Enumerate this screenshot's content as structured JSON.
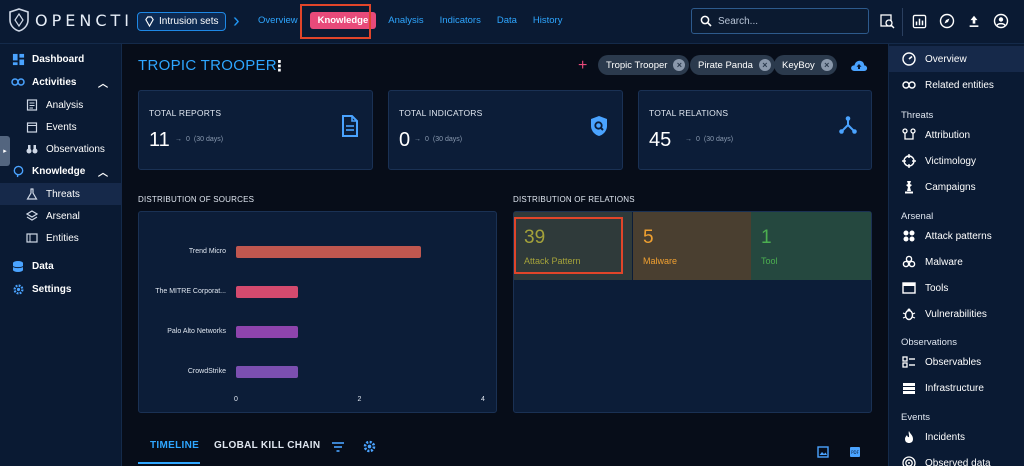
{
  "app": {
    "logo_text": "OPENCTI"
  },
  "header": {
    "entity_type": "Intrusion sets",
    "tabs": [
      "Overview",
      "Knowledge",
      "Analysis",
      "Indicators",
      "Data",
      "History"
    ],
    "active_tab": "Knowledge",
    "search_placeholder": "Search..."
  },
  "sidebar": {
    "items": [
      {
        "label": "Dashboard",
        "icon": "dashboard-icon"
      },
      {
        "label": "Activities",
        "icon": "activities-icon",
        "expanded": true
      },
      {
        "label": "Analysis",
        "icon": "analysis-icon"
      },
      {
        "label": "Events",
        "icon": "events-icon"
      },
      {
        "label": "Observations",
        "icon": "binoculars-icon"
      },
      {
        "label": "Knowledge",
        "icon": "brain-icon",
        "expanded": true
      },
      {
        "label": "Threats",
        "icon": "flask-icon",
        "selected": true
      },
      {
        "label": "Arsenal",
        "icon": "layers-icon"
      },
      {
        "label": "Entities",
        "icon": "entities-icon"
      },
      {
        "label": "Data",
        "icon": "database-icon"
      },
      {
        "label": "Settings",
        "icon": "gear-icon"
      }
    ]
  },
  "entity": {
    "title": "TROPIC TROOPER",
    "aliases": [
      "Tropic Trooper",
      "Pirate Panda",
      "KeyBoy"
    ]
  },
  "stats": [
    {
      "label": "TOTAL REPORTS",
      "value": "11",
      "delta": "0",
      "period": "(30 days)",
      "icon": "report-icon"
    },
    {
      "label": "TOTAL INDICATORS",
      "value": "0",
      "delta": "0",
      "period": "(30 days)",
      "icon": "indicator-shield-icon"
    },
    {
      "label": "TOTAL RELATIONS",
      "value": "45",
      "delta": "0",
      "period": "(30 days)",
      "icon": "relations-icon"
    }
  ],
  "sources": {
    "title": "DISTRIBUTION OF SOURCES",
    "chart_data": {
      "type": "bar",
      "orientation": "horizontal",
      "categories": [
        "Trend Micro",
        "The MITRE Corporat...",
        "Palo Alto Networks",
        "CrowdStrike"
      ],
      "values": [
        3,
        1,
        1,
        1
      ],
      "colors": [
        "#c0574f",
        "#d44a6e",
        "#8e44ad",
        "#7b4fb0"
      ],
      "xlim": [
        0,
        4
      ],
      "x_ticks": [
        "0",
        "2",
        "4"
      ]
    }
  },
  "relations": {
    "title": "DISTRIBUTION OF RELATIONS",
    "cells": [
      {
        "value": "39",
        "label": "Attack Pattern",
        "color": "#a4a23a",
        "bg": "#2f3a3a"
      },
      {
        "value": "5",
        "label": "Malware",
        "color": "#f0a030",
        "bg": "#4a3f30"
      },
      {
        "value": "1",
        "label": "Tool",
        "color": "#4caf50",
        "bg": "#25483f"
      }
    ]
  },
  "bottom_tabs": [
    "TIMELINE",
    "GLOBAL KILL CHAIN"
  ],
  "right_panel": {
    "items_top": [
      {
        "label": "Overview",
        "icon": "gauge-icon"
      },
      {
        "label": "Related entities",
        "icon": "link-icon"
      }
    ],
    "threats_title": "Threats",
    "threats": [
      {
        "label": "Attribution",
        "icon": "attribution-icon"
      },
      {
        "label": "Victimology",
        "icon": "crosshair-icon"
      },
      {
        "label": "Campaigns",
        "icon": "chess-icon"
      }
    ],
    "arsenal_title": "Arsenal",
    "arsenal": [
      {
        "label": "Attack patterns",
        "icon": "attack-pattern-icon"
      },
      {
        "label": "Malware",
        "icon": "biohazard-icon"
      },
      {
        "label": "Tools",
        "icon": "window-icon"
      },
      {
        "label": "Vulnerabilities",
        "icon": "bug-icon"
      }
    ],
    "observations_title": "Observations",
    "observations": [
      {
        "label": "Observables",
        "icon": "observables-icon"
      },
      {
        "label": "Infrastructure",
        "icon": "server-icon"
      }
    ],
    "events_title": "Events",
    "events": [
      {
        "label": "Incidents",
        "icon": "fire-icon"
      },
      {
        "label": "Observed data",
        "icon": "target-icon"
      }
    ]
  }
}
